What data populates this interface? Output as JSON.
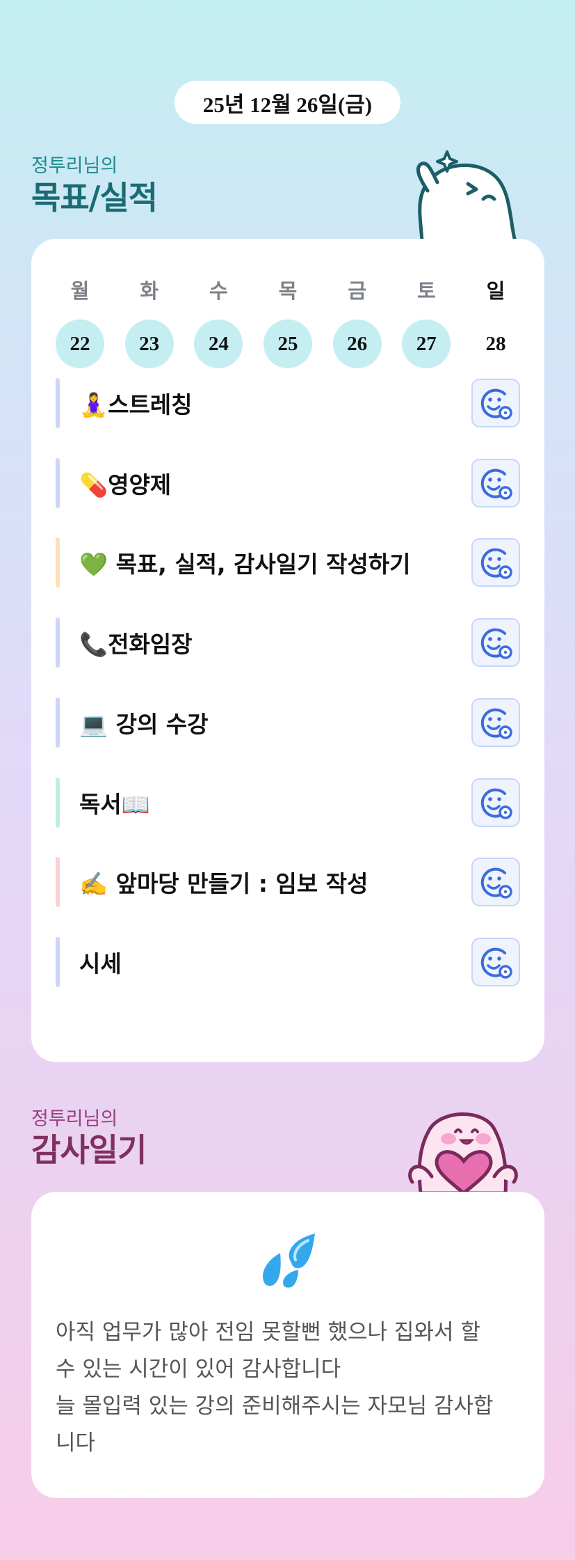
{
  "header": {
    "date": "25년 12월 26일(금)"
  },
  "goals_section": {
    "subtitle": "정투리님의",
    "title": "목표/실적",
    "weekdays": [
      "월",
      "화",
      "수",
      "목",
      "금",
      "토",
      "일"
    ],
    "days": [
      "22",
      "23",
      "24",
      "25",
      "26",
      "27",
      "28"
    ],
    "tasks": [
      {
        "label": "🧘‍♀️스트레칭",
        "bar_color": "#ccd5fb",
        "icon": "smiley-add-icon"
      },
      {
        "label": "💊영양제",
        "bar_color": "#ccd5fb",
        "icon": "smiley-add-icon"
      },
      {
        "label": "💚 목표, 실적, 감사일기 작성하기",
        "bar_color": "#fde0b8",
        "icon": "smiley-add-icon"
      },
      {
        "label": "📞전화임장",
        "bar_color": "#ccd5fb",
        "icon": "smiley-add-icon"
      },
      {
        "label": "💻 강의 수강",
        "bar_color": "#ccd5fb",
        "icon": "smiley-add-icon"
      },
      {
        "label": "독서📖",
        "bar_color": "#bdf0dc",
        "icon": "smiley-add-icon"
      },
      {
        "label": "✍️ 앞마당 만들기 : 임보 작성",
        "bar_color": "#fbd0d0",
        "icon": "smiley-add-icon"
      },
      {
        "label": "시세",
        "bar_color": "#ccd5fb",
        "icon": "smiley-add-icon"
      }
    ]
  },
  "gratitude_section": {
    "subtitle": "정투리님의",
    "title": "감사일기",
    "icon": "sweat-droplets-icon",
    "text": "아직 업무가 많아 전임 못할뻔 했으나 집와서 할\n수 있는 시간이 있어 감사합니다\n늘 몰입력 있는 강의 준비해주시는 자모님 감사합\n니다"
  },
  "colors": {
    "accent_circle": "#c4eef2",
    "goal_title": "#1a6b73",
    "gratitude_title": "#80305f",
    "smiley_blue": "#3a6be0"
  }
}
